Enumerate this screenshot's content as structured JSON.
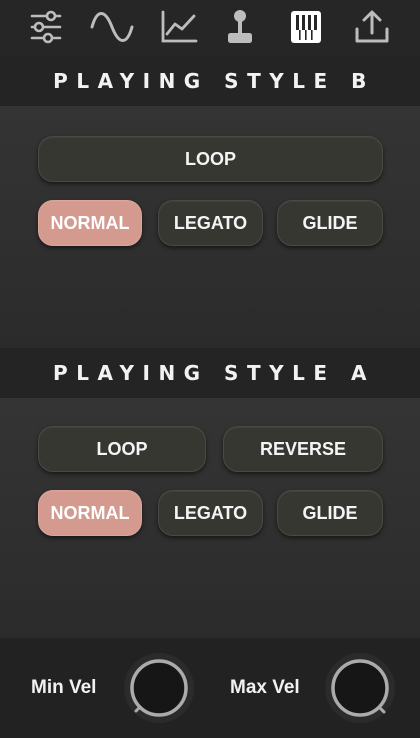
{
  "toolbar": {
    "icons": [
      "sliders-icon",
      "waveform-icon",
      "chart-icon",
      "joystick-icon",
      "keyboard-icon",
      "upload-icon"
    ]
  },
  "playing_style_b": {
    "title": "PLAYING STYLE B",
    "loop_label": "LOOP",
    "normal_label": "NORMAL",
    "legato_label": "LEGATO",
    "glide_label": "GLIDE",
    "active": "NORMAL"
  },
  "playing_style_a": {
    "title": "PLAYING STYLE A",
    "loop_label": "LOOP",
    "reverse_label": "REVERSE",
    "normal_label": "NORMAL",
    "legato_label": "LEGATO",
    "glide_label": "GLIDE",
    "active": "NORMAL"
  },
  "velocity": {
    "min_label": "Min Vel",
    "max_label": "Max Vel",
    "min_value": 0,
    "max_value": 1
  },
  "colors": {
    "accent": "#d49a90",
    "button": "#373731",
    "text": "#f2f2f2"
  }
}
